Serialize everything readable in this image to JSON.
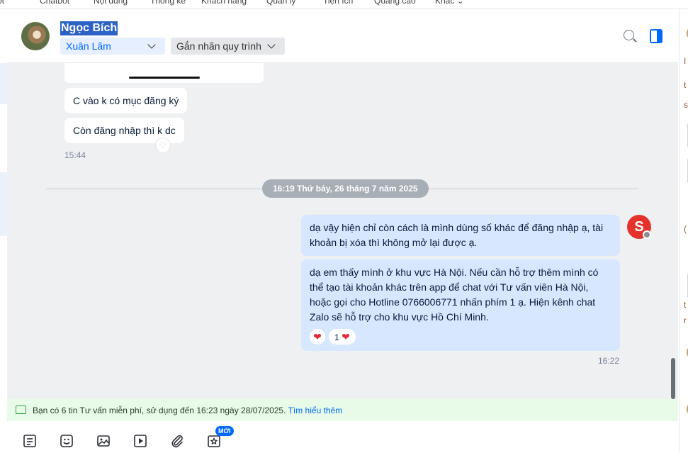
{
  "top_nav": [
    "ột",
    "Chatbot",
    "Nội dung",
    "Thống kê",
    "Khách hàng",
    "Quản lý",
    "Tiện ích",
    "Quảng cáo",
    "Khác ⌄"
  ],
  "header": {
    "contact_name": "Ngọc Bích",
    "assignee": "Xuân Lãm",
    "label_button": "Gắn nhãn quy trình"
  },
  "messages_in": [
    {
      "text": "C vào k có mục đăng ký"
    },
    {
      "text": "Còn đăng nhập thì k dc"
    }
  ],
  "time_in": "15:44",
  "date_divider": "16:19 Thứ bảy, 26 tháng 7 năm 2025",
  "messages_out": [
    {
      "text": "dạ vậy hiện chỉ còn cách là mình dùng số khác để đăng nhập ạ, tài khoản bị xóa thì không mở lại được ạ."
    },
    {
      "text": "dạ em thấy mình ở khu vực Hà Nội. Nếu cần hỗ trợ thêm mình có thể tạo tài khoản khác trên app để chat với Tư vấn viên Hà Nội, hoặc gọi cho Hotline 0766006771 nhấn phím 1 ạ. Hiện kênh chat Zalo sẽ hỗ trợ cho khu vực Hồ Chí Minh."
    }
  ],
  "reaction_count": "1",
  "time_out": "16:22",
  "notice": {
    "text": "Bạn có 6 tin Tư vấn miễn phí, sử dụng đến 16:23 ngày 28/07/2025.",
    "link": "Tìm hiểu thêm"
  },
  "toolbar_badge": "MỚI",
  "right_fragments": [
    "I",
    "t",
    "s",
    "(",
    "t",
    "r"
  ],
  "colors": {
    "accent": "#0068ff",
    "outgoing_bubble": "#d7e7ff",
    "notice_bg": "#e7fbe8"
  }
}
